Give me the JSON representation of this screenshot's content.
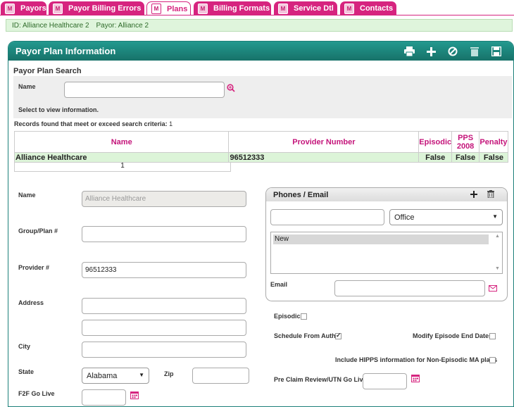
{
  "tabs": [
    "Payors",
    "Payor Billing Errors",
    "Plans",
    "Billing Formats",
    "Service Dtl",
    "Contacts"
  ],
  "active_tab": "Plans",
  "id_bar": {
    "id": "ID: Alliance Healthcare 2",
    "payor": "Payor: Alliance 2"
  },
  "panel": {
    "title": "Payor Plan Information"
  },
  "search": {
    "title": "Payor Plan Search",
    "name_label": "Name",
    "name_value": "",
    "hint": "Select to view information.",
    "records_label": "Records found that meet or exceed search criteria:",
    "records_count": "1"
  },
  "grid": {
    "headers": [
      "Name",
      "Provider Number",
      "Episodic",
      "PPS 2008",
      "Penalty"
    ],
    "rows": [
      [
        "Alliance Healthcare",
        "96512333",
        "False",
        "False",
        "False"
      ]
    ],
    "page": "1"
  },
  "form": {
    "name_label": "Name",
    "name_value": "Alliance Healthcare",
    "group_label": "Group/Plan #",
    "group_value": "",
    "provider_label": "Provider #",
    "provider_value": "96512333",
    "address_label": "Address",
    "address1": "",
    "address2": "",
    "city_label": "City",
    "city_value": "",
    "state_label": "State",
    "state_value": "Alabama",
    "zip_label": "Zip",
    "zip_value": "",
    "f2f_label": "F2F Go Live",
    "f2f_value": ""
  },
  "phones": {
    "title": "Phones / Email",
    "phone_value": "",
    "type_value": "Office",
    "list_item": "New",
    "email_label": "Email",
    "email_value": ""
  },
  "options": {
    "episodic_label": "Episodic",
    "episodic_checked": false,
    "schedule_label": "Schedule From Auth",
    "schedule_checked": true,
    "modify_label": "Modify Episode End Dates",
    "modify_checked": false,
    "hipps_label": "Include HIPPS information for Non-Episodic MA plans",
    "hipps_checked": false,
    "preclaim_label": "Pre Claim Review/UTN Go Live",
    "preclaim_value": ""
  },
  "colors": {
    "accent": "#d6247f",
    "header": "#1c8a80",
    "row": "#dcf4d8"
  }
}
